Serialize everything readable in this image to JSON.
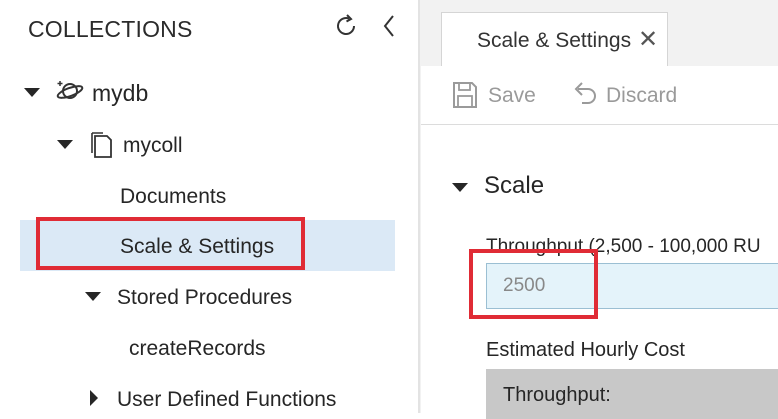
{
  "sidebar": {
    "header": "COLLECTIONS",
    "tree": {
      "database": "mydb",
      "collection": "mycoll",
      "documents": "Documents",
      "scale_settings": "Scale & Settings",
      "stored_procedures": "Stored Procedures",
      "create_records": "createRecords",
      "user_defined_functions": "User Defined Functions"
    }
  },
  "tab": {
    "label": "Scale & Settings",
    "close_glyph": "✕"
  },
  "toolbar": {
    "save_label": "Save",
    "discard_label": "Discard"
  },
  "scale": {
    "title": "Scale",
    "throughput_label": "Throughput (2,500 - 100,000 RU",
    "throughput_value": "2500",
    "estimated_cost_label": "Estimated Hourly Cost",
    "estimated_cost_row": "Throughput:"
  },
  "colors": {
    "selection": "#dbe9f6",
    "highlight_box": "#e02b35",
    "input_background": "#e4f3fa"
  }
}
